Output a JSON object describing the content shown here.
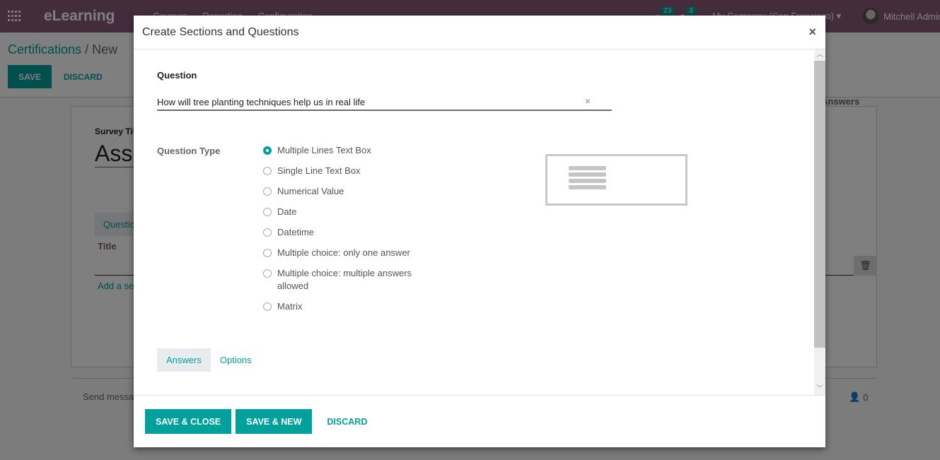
{
  "app": {
    "brand": "eLearning",
    "menu": [
      "Courses",
      "Reporting",
      "Configuration"
    ],
    "activity_count": "23",
    "message_count": "3",
    "company": "My Company (San Francisco)",
    "user": "Mitchell Admin"
  },
  "control_panel": {
    "breadcrumb_parent": "Certifications",
    "breadcrumb_sep": "/",
    "breadcrumb_current": "New",
    "save_label": "SAVE",
    "discard_label": "DISCARD"
  },
  "sheet": {
    "survey_title_label": "Survey Title",
    "survey_title_value": "Assessment",
    "tab_label": "Questions",
    "col_title": "Title",
    "col_answers": "Answers",
    "add_section_link": "Add a section"
  },
  "chatter": {
    "send_message": "Send message",
    "followers_count": "0"
  },
  "modal": {
    "title": "Create Sections and Questions",
    "close_glyph": "×",
    "question_label": "Question",
    "question_value": "How will tree planting techniques help us in real life",
    "clear_glyph": "×",
    "question_type_label": "Question Type",
    "question_types": [
      {
        "label": "Multiple Lines Text Box",
        "checked": true
      },
      {
        "label": "Single Line Text Box",
        "checked": false
      },
      {
        "label": "Numerical Value",
        "checked": false
      },
      {
        "label": "Date",
        "checked": false
      },
      {
        "label": "Datetime",
        "checked": false
      },
      {
        "label": "Multiple choice: only one answer",
        "checked": false
      },
      {
        "label": "Multiple choice: multiple answers allowed",
        "checked": false
      },
      {
        "label": "Matrix",
        "checked": false
      }
    ],
    "tabs": [
      {
        "label": "Answers",
        "active": true
      },
      {
        "label": "Options",
        "active": false
      }
    ],
    "footer": {
      "save_close": "SAVE & CLOSE",
      "save_new": "SAVE & NEW",
      "discard": "DISCARD"
    }
  },
  "colors": {
    "brand": "#875a7b",
    "accent": "#00a09d"
  }
}
